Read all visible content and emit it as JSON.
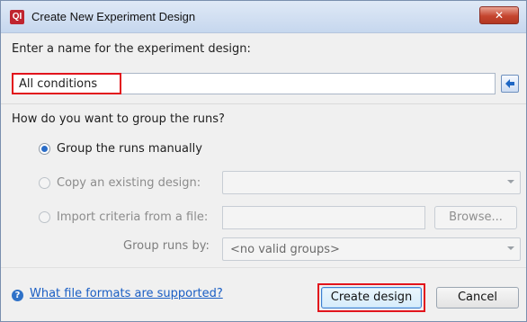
{
  "window": {
    "app_icon_text": "QI",
    "title": "Create New Experiment Design",
    "close_symbol": "✕"
  },
  "name_section": {
    "prompt": "Enter a name for the experiment design:",
    "value": "All conditions",
    "back_icon": "arrow-left-icon"
  },
  "grouping": {
    "question": "How do you want to group the runs?",
    "options": [
      {
        "label": "Group the runs manually",
        "checked": true,
        "enabled": true
      },
      {
        "label": "Copy an existing design:",
        "checked": false,
        "enabled": false
      },
      {
        "label": "Import criteria from a file:",
        "checked": false,
        "enabled": false
      }
    ],
    "browse_label": "Browse...",
    "group_by_label": "Group runs by:",
    "group_by_value": "<no valid groups>"
  },
  "footer": {
    "help_symbol": "?",
    "help_link": "What file formats are supported?",
    "create_label": "Create design",
    "cancel_label": "Cancel"
  },
  "colors": {
    "accent": "#2b6dc8",
    "highlight_red": "#e2141c",
    "link": "#1a5ec4"
  }
}
